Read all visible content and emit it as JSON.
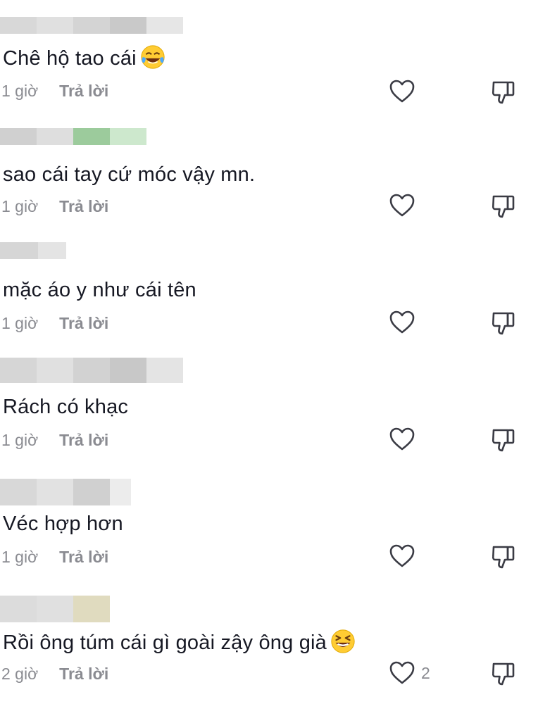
{
  "comments": [
    {
      "text": "Chê hộ tao cái",
      "emoji": "face-with-tears-of-joy",
      "time": "1 giờ",
      "reply": "Trả lời",
      "likes": ""
    },
    {
      "text": "sao cái tay cứ móc vậy mn.",
      "emoji": "",
      "time": "1 giờ",
      "reply": "Trả lời",
      "likes": ""
    },
    {
      "text": "mặc áo y như cái tên",
      "emoji": "",
      "time": "1 giờ",
      "reply": "Trả lời",
      "likes": ""
    },
    {
      "text": "Rách có khạc",
      "emoji": "",
      "time": "1 giờ",
      "reply": "Trả lời",
      "likes": ""
    },
    {
      "text": "Véc hợp hơn",
      "emoji": "",
      "time": "1 giờ",
      "reply": "Trả lời",
      "likes": ""
    },
    {
      "text": "Rồi ông túm cái gì goài zậy ông già",
      "emoji": "grinning-squinting-face",
      "time": "2 giờ",
      "reply": "Trả lời",
      "likes": "2"
    }
  ],
  "icons": {
    "like": "heart-outline-icon",
    "dislike": "thumbs-down-icon"
  },
  "colors": {
    "text": "#161823",
    "meta": "#8a8b91",
    "background": "#ffffff"
  }
}
